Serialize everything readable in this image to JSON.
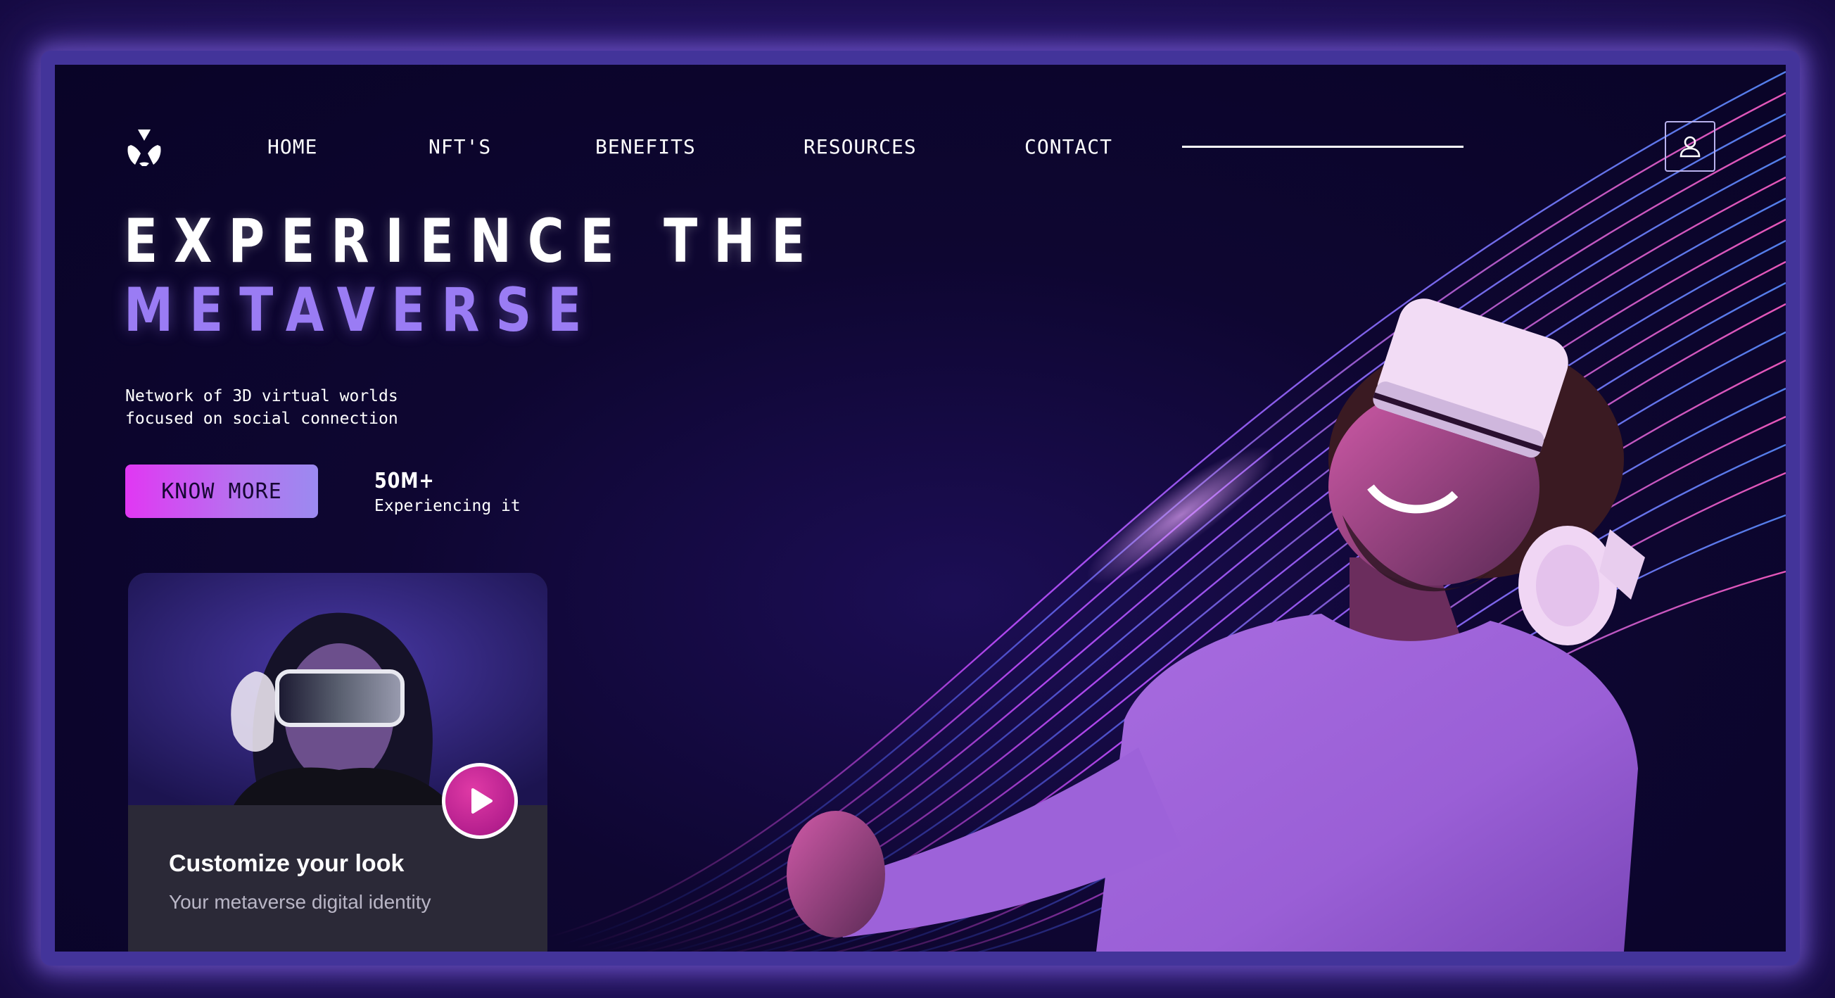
{
  "nav": {
    "items": [
      {
        "label": "HOME"
      },
      {
        "label": "NFT'S"
      },
      {
        "label": "BENEFITS"
      },
      {
        "label": "RESOURCES"
      },
      {
        "label": "CONTACT"
      }
    ],
    "logo_icon": "tri-segment-circle-logo",
    "user_icon": "user-icon"
  },
  "hero": {
    "line1": "EXPERIENCE THE",
    "line2": "METAVERSE",
    "tagline_line1": "Network of 3D virtual worlds",
    "tagline_line2": "focused on social connection",
    "cta_label": "KNOW MORE",
    "stat_value": "50M+",
    "stat_label": "Experiencing it"
  },
  "card": {
    "title": "Customize your look",
    "subtitle": "Your metaverse digital identity",
    "play_icon": "play-icon"
  },
  "colors": {
    "accent_purple": "#9a7cf4",
    "cta_magenta": "#e137f3",
    "background": "#0e0631",
    "frame": "#43349a"
  }
}
